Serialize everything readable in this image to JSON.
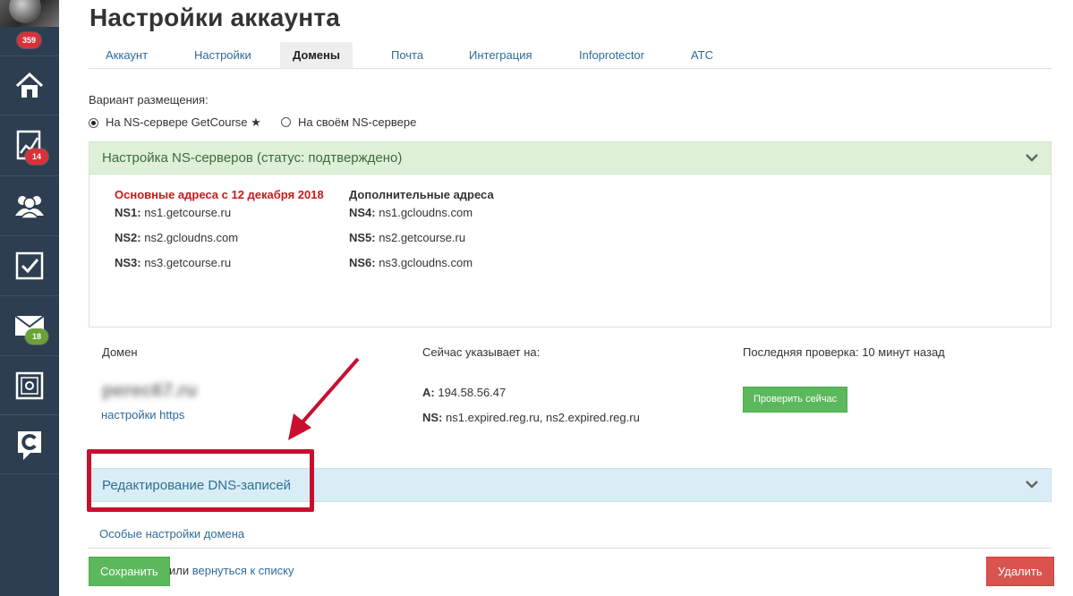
{
  "sidebar": {
    "badges": {
      "avatar": "359",
      "analytics": "14",
      "messages": "18"
    },
    "icons": [
      "home-icon",
      "chart-icon",
      "users-icon",
      "tasks-icon",
      "mail-icon",
      "settings-safe-icon",
      "getcourse-logo-icon"
    ]
  },
  "header": {
    "title": "Настройки аккаунта"
  },
  "tabs": [
    {
      "label": "Аккаунт"
    },
    {
      "label": "Настройки"
    },
    {
      "label": "Домены",
      "active": true
    },
    {
      "label": "Почта"
    },
    {
      "label": "Интеграция"
    },
    {
      "label": "Infoprotector"
    },
    {
      "label": "АТС"
    }
  ],
  "placement": {
    "label": "Вариант размещения:",
    "option_getcourse": "На NS-сервере GetCourse ★",
    "option_own": "На своём NS-сервере",
    "selected": "getcourse"
  },
  "ns_panel": {
    "title": "Настройка NS-серверов (статус: подтверждено)",
    "primary_title": "Основные адреса с 12 декабря 2018",
    "additional_title": "Дополнительные адреса",
    "primary": [
      {
        "key": "NS1:",
        "value": "ns1.getcourse.ru"
      },
      {
        "key": "NS2:",
        "value": "ns2.gcloudns.com"
      },
      {
        "key": "NS3:",
        "value": "ns3.getcourse.ru"
      }
    ],
    "additional": [
      {
        "key": "NS4:",
        "value": "ns1.gcloudns.com"
      },
      {
        "key": "NS5:",
        "value": "ns2.getcourse.ru"
      },
      {
        "key": "NS6:",
        "value": "ns3.gcloudns.com"
      }
    ]
  },
  "domain": {
    "label": "Домен",
    "name": "perec67.ru",
    "https_link": "настройки https",
    "points_to_label": "Сейчас указывает на:",
    "a_key": "A:",
    "a_value": "194.58.56.47",
    "ns_key": "NS:",
    "ns_value": "ns1.expired.reg.ru, ns2.expired.reg.ru",
    "last_check": "Последняя проверка: 10 минут назад",
    "check_button": "Проверить сейчас"
  },
  "dns_panel": {
    "title": "Редактирование DNS-записей"
  },
  "special_settings_link": "Особые настройки домена",
  "footer": {
    "save": "Сохранить",
    "or": "или",
    "back_link": "вернуться к списку",
    "delete": "Удалить"
  },
  "colors": {
    "sidebar": "#2c3e50",
    "success_panel": "#dff0d8",
    "info_panel": "#d9edf7",
    "link": "#2e6b9a",
    "annotation": "#c8102e"
  }
}
